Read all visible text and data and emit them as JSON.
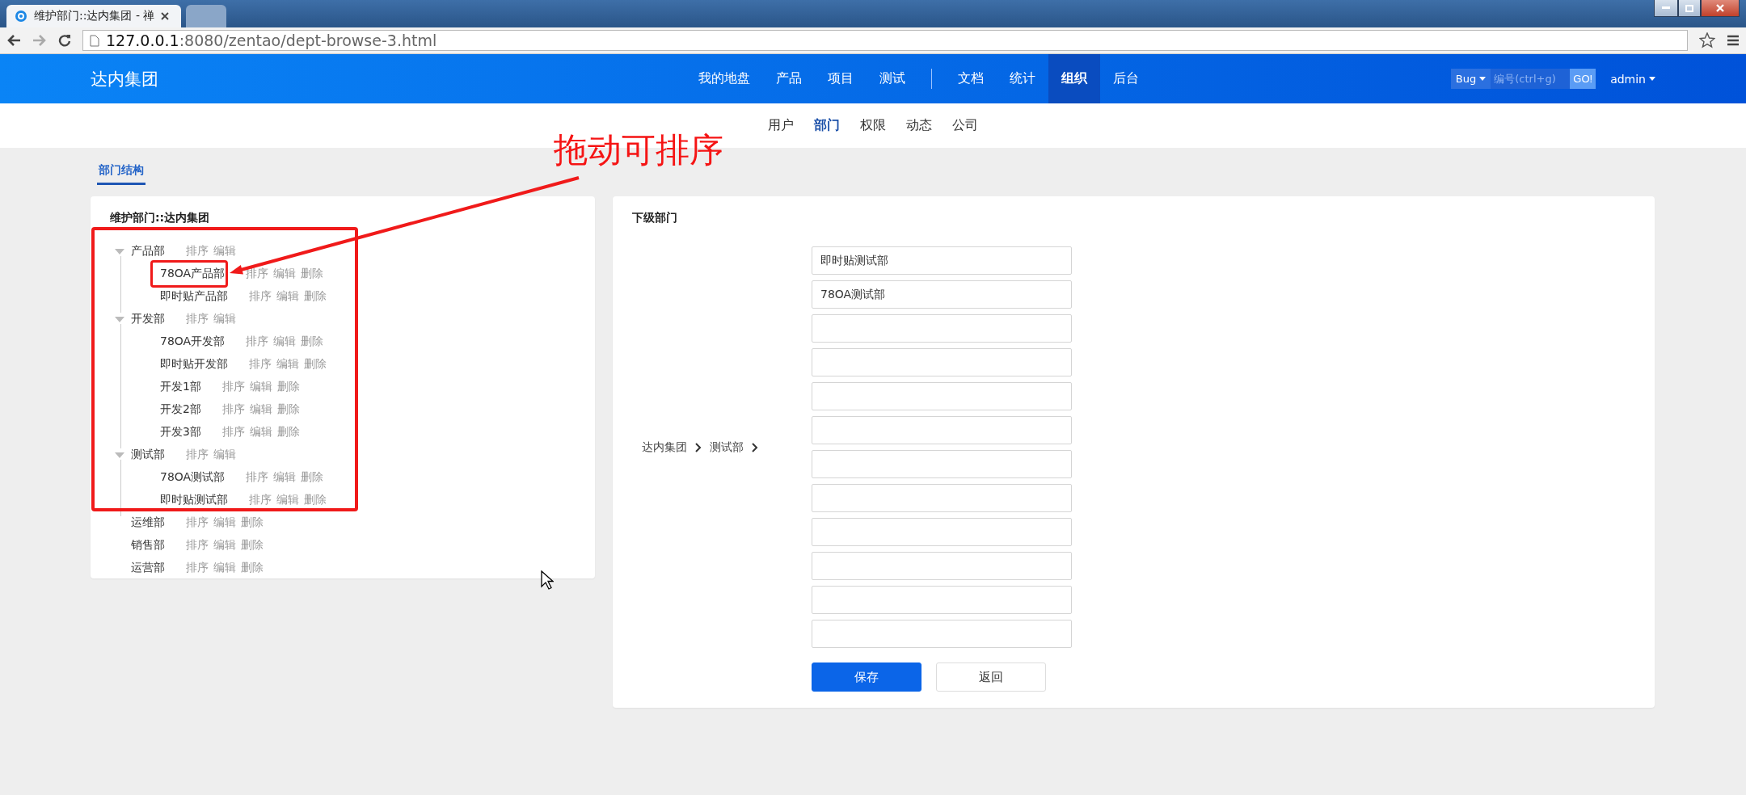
{
  "browser": {
    "tabs": [
      {
        "title": "维护部门::达内集团 - 禅",
        "selected": true
      },
      {
        "selected": false
      }
    ],
    "address": {
      "host": "127.0.0.1",
      "path": ":8080/zentao/dept-browse-3.html"
    }
  },
  "navbar": {
    "brand": "达内集团",
    "menu": [
      {
        "label": "我的地盘",
        "selected": false
      },
      {
        "label": "产品",
        "selected": false
      },
      {
        "label": "项目",
        "selected": false
      },
      {
        "label": "测试",
        "selected": false,
        "divider_after": true
      },
      {
        "label": "文档",
        "selected": false
      },
      {
        "label": "统计",
        "selected": false
      },
      {
        "label": "组织",
        "selected": true
      },
      {
        "label": "后台",
        "selected": false
      }
    ],
    "search": {
      "type": "Bug",
      "placeholder": "编号(ctrl+g)",
      "button": "GO!"
    },
    "user": "admin"
  },
  "subnav": [
    {
      "label": "用户",
      "selected": false
    },
    {
      "label": "部门",
      "selected": true
    },
    {
      "label": "权限",
      "selected": false
    },
    {
      "label": "动态",
      "selected": false
    },
    {
      "label": "公司",
      "selected": false
    }
  ],
  "page_tab": "部门结构",
  "tree_panel": {
    "title": "维护部门::达内集团",
    "nodes": [
      {
        "name": "产品部",
        "actions": [
          "排序",
          "编辑"
        ],
        "children": [
          {
            "name": "78OA产品部",
            "actions": [
              "排序",
              "编辑",
              "删除"
            ]
          },
          {
            "name": "即时贴产品部",
            "actions": [
              "排序",
              "编辑",
              "删除"
            ]
          }
        ]
      },
      {
        "name": "开发部",
        "actions": [
          "排序",
          "编辑"
        ],
        "children": [
          {
            "name": "78OA开发部",
            "actions": [
              "排序",
              "编辑",
              "删除"
            ]
          },
          {
            "name": "即时贴开发部",
            "actions": [
              "排序",
              "编辑",
              "删除"
            ]
          },
          {
            "name": "开发1部",
            "actions": [
              "排序",
              "编辑",
              "删除"
            ]
          },
          {
            "name": "开发2部",
            "actions": [
              "排序",
              "编辑",
              "删除"
            ]
          },
          {
            "name": "开发3部",
            "actions": [
              "排序",
              "编辑",
              "删除"
            ]
          }
        ]
      },
      {
        "name": "测试部",
        "actions": [
          "排序",
          "编辑"
        ],
        "children": [
          {
            "name": "78OA测试部",
            "actions": [
              "排序",
              "编辑",
              "删除"
            ]
          },
          {
            "name": "即时贴测试部",
            "actions": [
              "排序",
              "编辑",
              "删除"
            ]
          }
        ]
      },
      {
        "name": "运维部",
        "actions": [
          "排序",
          "编辑",
          "删除"
        ]
      },
      {
        "name": "销售部",
        "actions": [
          "排序",
          "编辑",
          "删除"
        ]
      },
      {
        "name": "运营部",
        "actions": [
          "排序",
          "编辑",
          "删除"
        ]
      }
    ]
  },
  "child_panel": {
    "title": "下级部门",
    "breadcrumb": [
      "达内集团",
      "测试部"
    ],
    "fields": [
      {
        "kind": "input",
        "value": "即时贴测试部"
      },
      {
        "kind": "input",
        "value": "78OA测试部"
      },
      {
        "kind": "input"
      },
      {
        "kind": "input"
      },
      {
        "kind": "input"
      },
      {
        "kind": "input"
      },
      {
        "kind": "input"
      },
      {
        "kind": "input"
      },
      {
        "kind": "input"
      },
      {
        "kind": "input"
      },
      {
        "kind": "input"
      },
      {
        "kind": "input"
      }
    ],
    "buttons": [
      {
        "label": "保存",
        "kind": "primary"
      },
      {
        "label": "返回",
        "kind": "default"
      }
    ]
  },
  "annotation": {
    "text": "拖动可排序"
  }
}
